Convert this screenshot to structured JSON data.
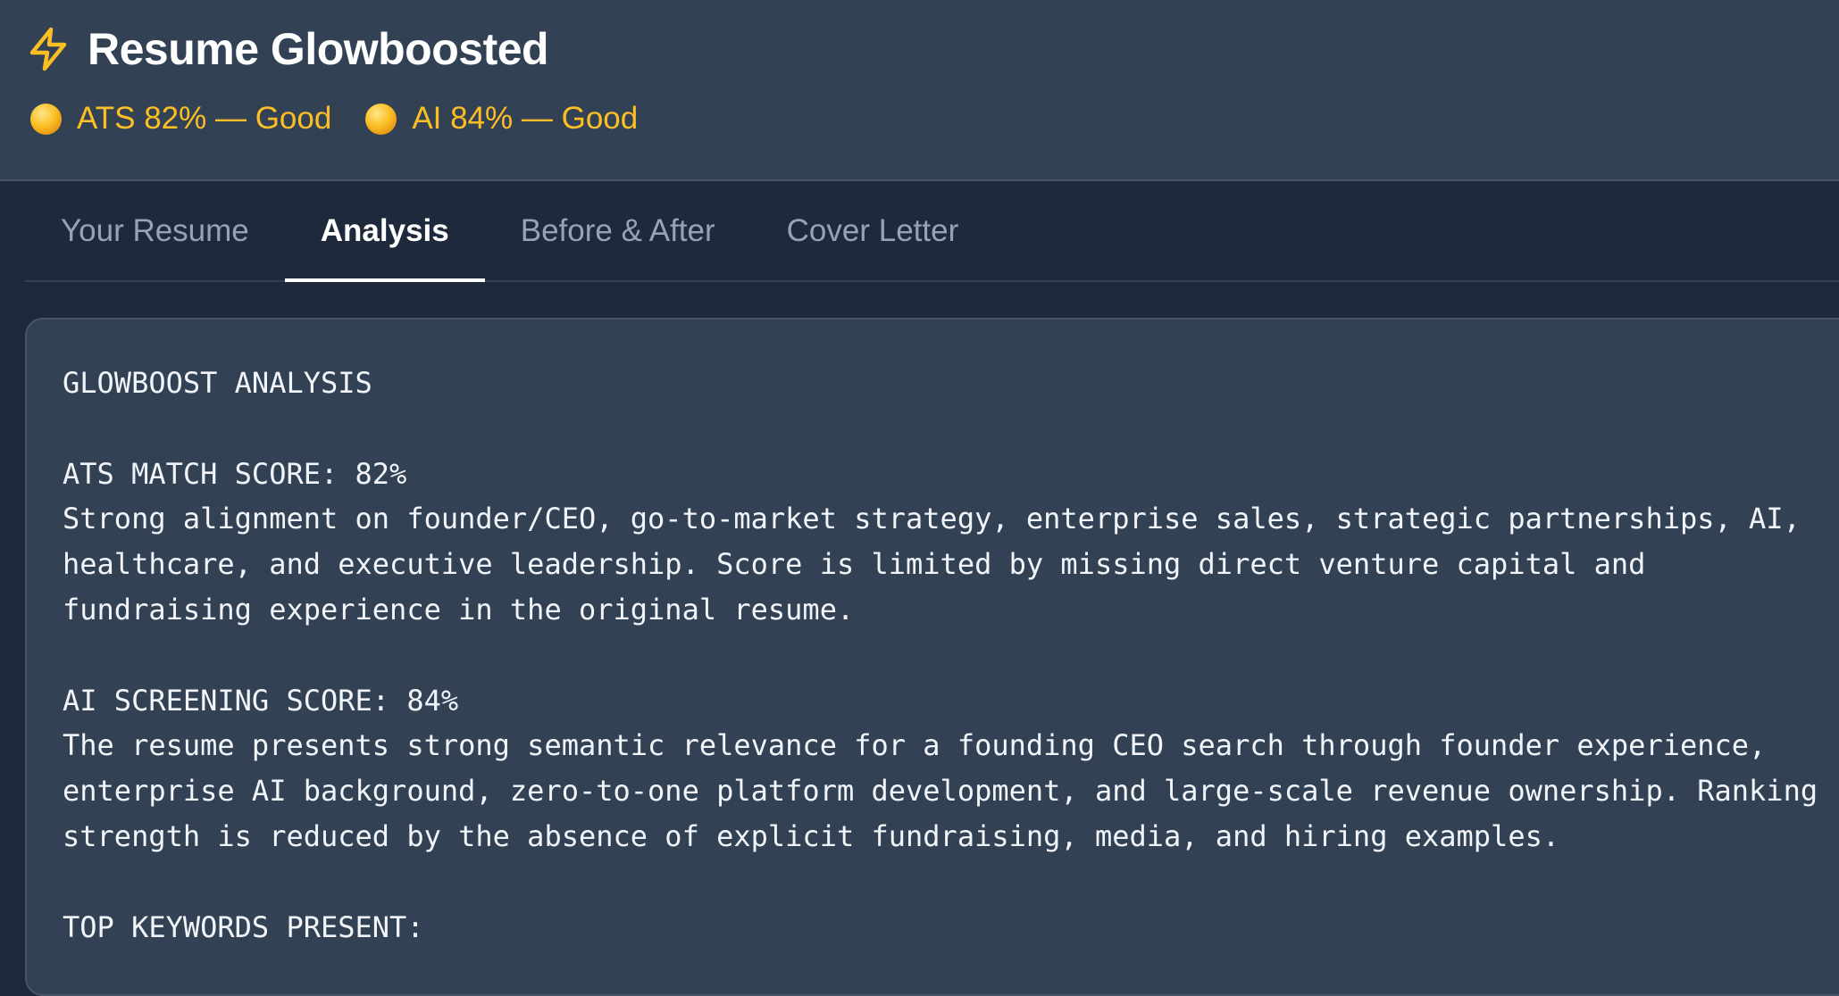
{
  "app": {
    "title": "Resume Glowboosted",
    "icon": "lightning-bolt-icon"
  },
  "scores": [
    {
      "label": "ATS 82% — Good",
      "value": 82,
      "status": "Good",
      "color": "#fbbf24"
    },
    {
      "label": "AI 84% — Good",
      "value": 84,
      "status": "Good",
      "color": "#fbbf24"
    }
  ],
  "tabs": [
    {
      "label": "Your Resume",
      "active": false
    },
    {
      "label": "Analysis",
      "active": true
    },
    {
      "label": "Before & After",
      "active": false
    },
    {
      "label": "Cover Letter",
      "active": false
    }
  ],
  "analysis": {
    "heading": "GLOWBOOST ANALYSIS",
    "ats_heading": "ATS MATCH SCORE: 82%",
    "ats_line1": "Strong alignment on founder/CEO, go-to-market strategy, enterprise sales, strategic partnerships, AI,",
    "ats_line2": "healthcare, and executive leadership. Score is limited by missing direct venture capital and",
    "ats_line3": "fundraising experience in the original resume.",
    "ai_heading": "AI SCREENING SCORE: 84%",
    "ai_line1": "The resume presents strong semantic relevance for a founding CEO search through founder experience,",
    "ai_line2": "enterprise AI background, zero-to-one platform development, and large-scale revenue ownership. Ranking",
    "ai_line3": "strength is reduced by the absence of explicit fundraising, media, and hiring examples.",
    "keywords_heading": "TOP KEYWORDS PRESENT:"
  },
  "colors": {
    "background": "#1e293b",
    "header": "#334155",
    "accent": "#fbbf24",
    "text": "#f1f5f9",
    "muted": "#94a3b8"
  }
}
